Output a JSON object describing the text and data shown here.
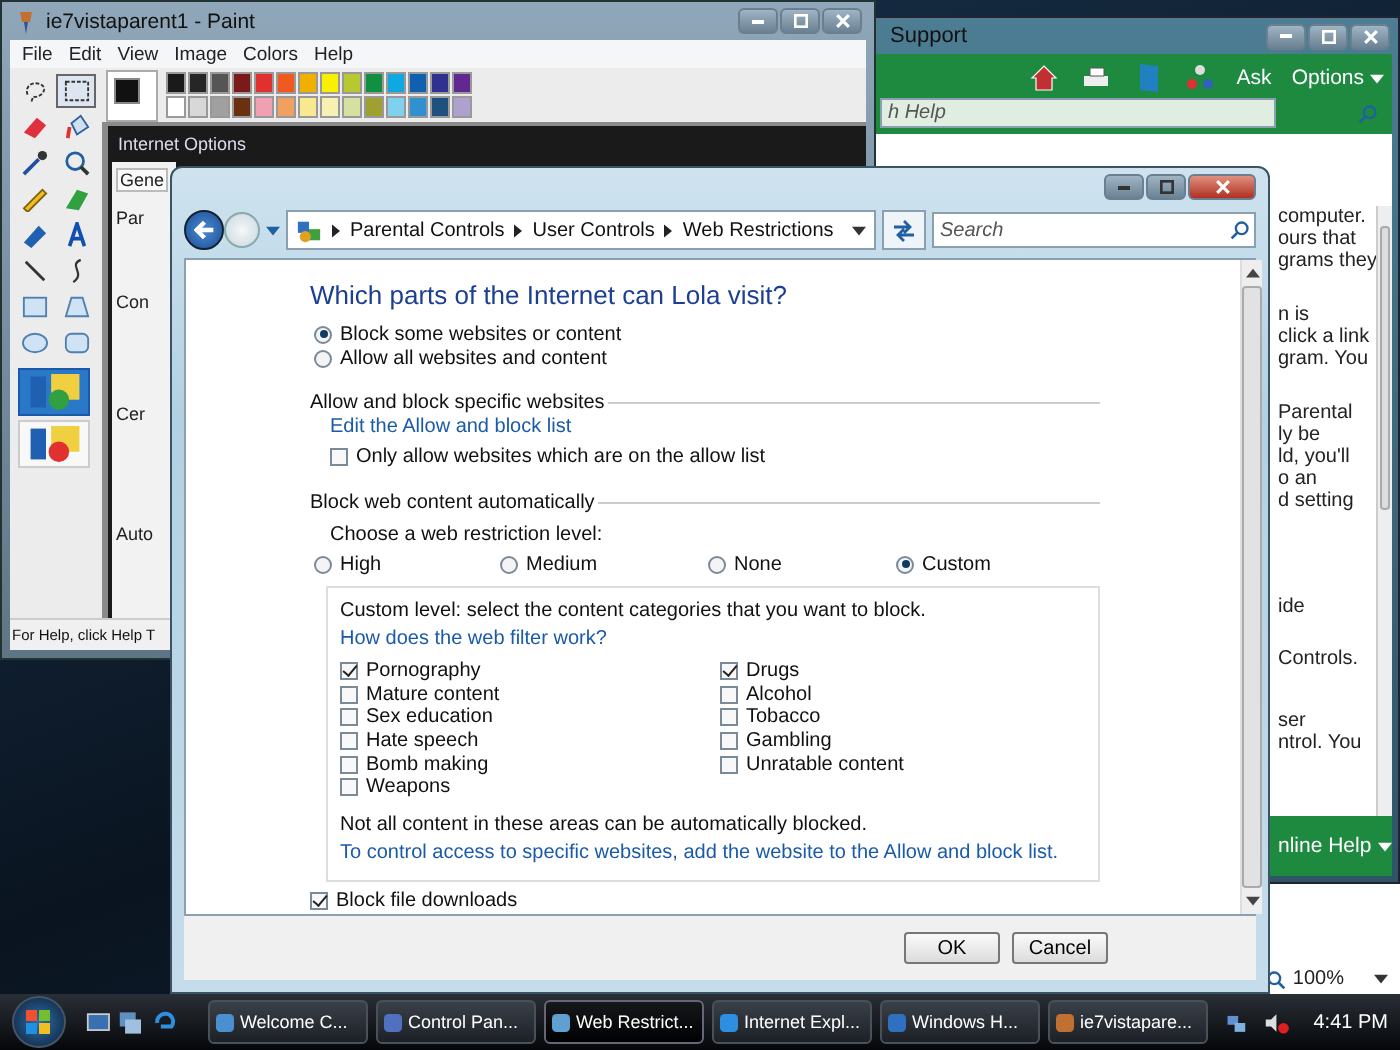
{
  "paint": {
    "title": "ie7vistaparent1 - Paint",
    "menu": [
      "File",
      "Edit",
      "View",
      "Image",
      "Colors",
      "Help"
    ],
    "tools": [
      {
        "kind": "free-select",
        "selected": false
      },
      {
        "kind": "select",
        "selected": true
      },
      {
        "kind": "eraser",
        "selected": false
      },
      {
        "kind": "fill",
        "selected": false
      },
      {
        "kind": "picker",
        "selected": false
      },
      {
        "kind": "magnifier",
        "selected": false
      },
      {
        "kind": "pencil",
        "selected": false
      },
      {
        "kind": "brush",
        "selected": false
      },
      {
        "kind": "airbrush",
        "selected": false
      },
      {
        "kind": "text",
        "selected": false
      },
      {
        "kind": "line",
        "selected": false
      },
      {
        "kind": "curve",
        "selected": false
      },
      {
        "kind": "rectangle",
        "selected": false
      },
      {
        "kind": "polygon",
        "selected": false
      },
      {
        "kind": "ellipse",
        "selected": false
      },
      {
        "kind": "rounded-rectangle",
        "selected": false
      }
    ],
    "tool_options": [
      {
        "selected": true
      },
      {
        "selected": false
      }
    ],
    "palette": [
      {
        "color": "#1a1a1a"
      },
      {
        "color": "#262626"
      },
      {
        "color": "#555555"
      },
      {
        "color": "#7a1a1a"
      },
      {
        "color": "#e03030"
      },
      {
        "color": "#f05a20"
      },
      {
        "color": "#f0b000"
      },
      {
        "color": "#f8f000"
      },
      {
        "color": "#b8c830"
      },
      {
        "color": "#109040"
      },
      {
        "color": "#10a8e0"
      },
      {
        "color": "#1060b0"
      },
      {
        "color": "#303090"
      },
      {
        "color": "#602890"
      },
      {
        "color": "#ffffff"
      },
      {
        "color": "#d8d8d8"
      },
      {
        "color": "#a0a0a0"
      },
      {
        "color": "#6a3010"
      },
      {
        "color": "#f0a0b0"
      },
      {
        "color": "#f0a060"
      },
      {
        "color": "#f8e890"
      },
      {
        "color": "#f8f0b0"
      },
      {
        "color": "#d8e0a0"
      },
      {
        "color": "#a0a030"
      },
      {
        "color": "#80d0f0"
      },
      {
        "color": "#3090d0"
      },
      {
        "color": "#205080"
      },
      {
        "color": "#b0a0d0"
      }
    ],
    "canvas": {
      "title": "Internet Options",
      "tab": "Gene",
      "labels": [
        "Par",
        "Con",
        "Cer",
        "Auto"
      ]
    },
    "status": "For Help, click Help T"
  },
  "help_window": {
    "title": "Support",
    "toolbar": {
      "ask": "Ask",
      "options": "Options"
    },
    "search": {
      "placeholder": "h Help"
    },
    "paragraphs": [
      [
        "computer.",
        "ours that",
        "grams they"
      ],
      [
        "n is",
        "click a link",
        "gram. You"
      ],
      [
        "Parental",
        "ly be",
        "ld, you'll",
        "o an",
        "d setting"
      ],
      [
        "ide"
      ],
      [
        "Controls."
      ],
      [
        "ser",
        "ntrol. You"
      ]
    ],
    "footer": "nline Help"
  },
  "ie_window": {
    "zoom": "100%"
  },
  "dialog": {
    "breadcrumb": [
      "Parental Controls",
      "User Controls",
      "Web Restrictions"
    ],
    "search": {
      "placeholder": "Search"
    },
    "heading": "Which parts of the Internet can Lola visit?",
    "modes": [
      {
        "label": "Block some websites or content",
        "selected": true
      },
      {
        "label": "Allow all websites and content",
        "selected": false
      }
    ],
    "allow_block": {
      "title": "Allow and block specific websites",
      "link": "Edit the Allow and block list",
      "only_allow": {
        "label": "Only allow websites which are on the allow list",
        "checked": false
      }
    },
    "auto_block": {
      "title": "Block web content automatically",
      "prompt": "Choose a web restriction level:",
      "levels": [
        {
          "label": "High",
          "selected": false
        },
        {
          "label": "Medium",
          "selected": false
        },
        {
          "label": "None",
          "selected": false
        },
        {
          "label": "Custom",
          "selected": true
        }
      ],
      "custom": {
        "intro": "Custom level: select the content categories that you want to block.",
        "help_link": "How does the web filter work?",
        "columns": [
          [
            {
              "label": "Pornography",
              "checked": true
            },
            {
              "label": "Mature content",
              "checked": false
            },
            {
              "label": "Sex education",
              "checked": false
            },
            {
              "label": "Hate speech",
              "checked": false
            },
            {
              "label": "Bomb making",
              "checked": false
            },
            {
              "label": "Weapons",
              "checked": false
            }
          ],
          [
            {
              "label": "Drugs",
              "checked": true
            },
            {
              "label": "Alcohol",
              "checked": false
            },
            {
              "label": "Tobacco",
              "checked": false
            },
            {
              "label": "Gambling",
              "checked": false
            },
            {
              "label": "Unratable content",
              "checked": false
            }
          ]
        ],
        "note": "Not all content in these areas can be automatically blocked.",
        "note_link": "To control access to specific websites, add the website to the Allow and block list."
      }
    },
    "block_downloads": {
      "label": "Block file downloads",
      "checked": true
    },
    "buttons": [
      "OK",
      "Cancel"
    ]
  },
  "taskbar": {
    "tasks": [
      {
        "label": "Welcome C...",
        "selected": false
      },
      {
        "label": "Control Pan...",
        "selected": false
      },
      {
        "label": "Web Restrict...",
        "selected": true
      },
      {
        "label": "Internet Expl...",
        "selected": false
      },
      {
        "label": "Windows H...",
        "selected": false
      },
      {
        "label": "ie7vistapare...",
        "selected": false
      }
    ],
    "clock": "4:41 PM"
  }
}
